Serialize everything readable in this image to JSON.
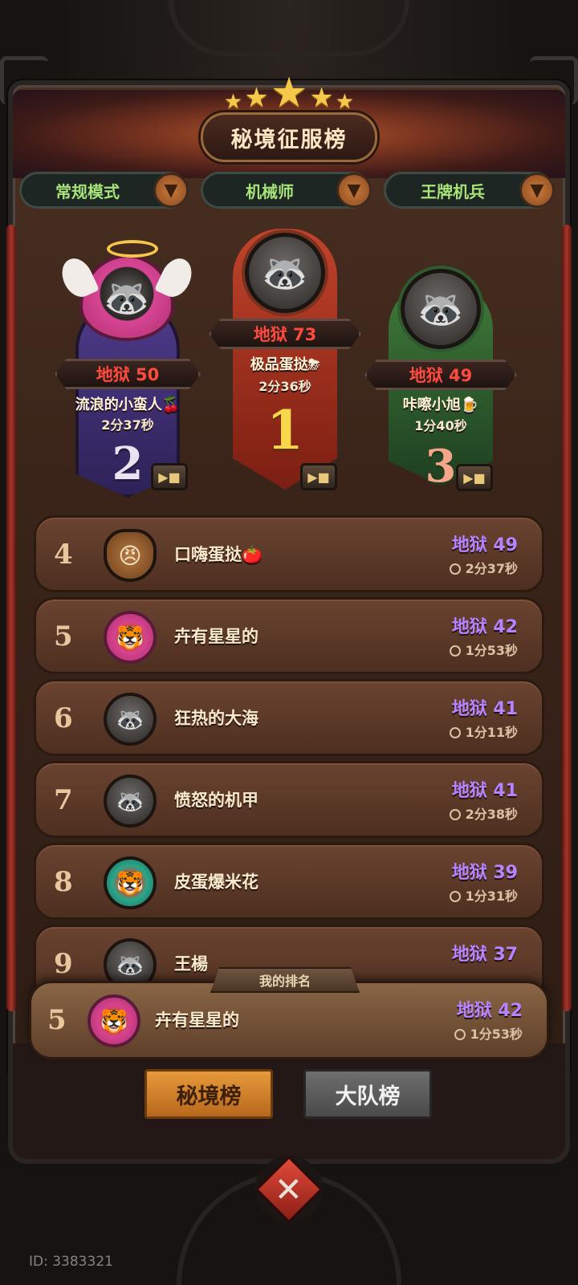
{
  "header": {
    "title": "秘境征服榜"
  },
  "filters": [
    {
      "label": "常规模式"
    },
    {
      "label": "机械师"
    },
    {
      "label": "王牌机兵"
    }
  ],
  "podium": {
    "first": {
      "rank": "1",
      "score": "地狱 73",
      "name": "极品蛋挞⛈",
      "time": "2分36秒"
    },
    "second": {
      "rank": "2",
      "score": "地狱 50",
      "name": "流浪的小蛮人🍒",
      "time": "2分37秒"
    },
    "third": {
      "rank": "3",
      "score": "地狱 49",
      "name": "咔嚓小旭🍺",
      "time": "1分40秒"
    }
  },
  "rows": [
    {
      "rank": "4",
      "name": "口嗨蛋挞🍅",
      "score": "地狱 49",
      "time": "2分37秒"
    },
    {
      "rank": "5",
      "name": "卉有星星的",
      "score": "地狱 42",
      "time": "1分53秒"
    },
    {
      "rank": "6",
      "name": "狂热的大海",
      "score": "地狱 41",
      "time": "1分11秒"
    },
    {
      "rank": "7",
      "name": "愤怒的机甲",
      "score": "地狱 41",
      "time": "2分38秒"
    },
    {
      "rank": "8",
      "name": "皮蛋爆米花",
      "score": "地狱 39",
      "time": "1分31秒"
    },
    {
      "rank": "9",
      "name": "王楊",
      "score": "地狱 37",
      "time": ""
    }
  ],
  "my_rank": {
    "tag": "我的排名",
    "rank": "5",
    "name": "卉有星星的",
    "score": "地狱 42",
    "time": "1分53秒"
  },
  "tabs": [
    {
      "label": "秘境榜"
    },
    {
      "label": "大队榜"
    }
  ],
  "footer": {
    "id": "ID: 3383321"
  },
  "colors": {
    "score_red": "#ff4b3e",
    "score_purple": "#b784ff",
    "filter_green": "#a8e37a",
    "tab_active": "#e69a3a"
  }
}
